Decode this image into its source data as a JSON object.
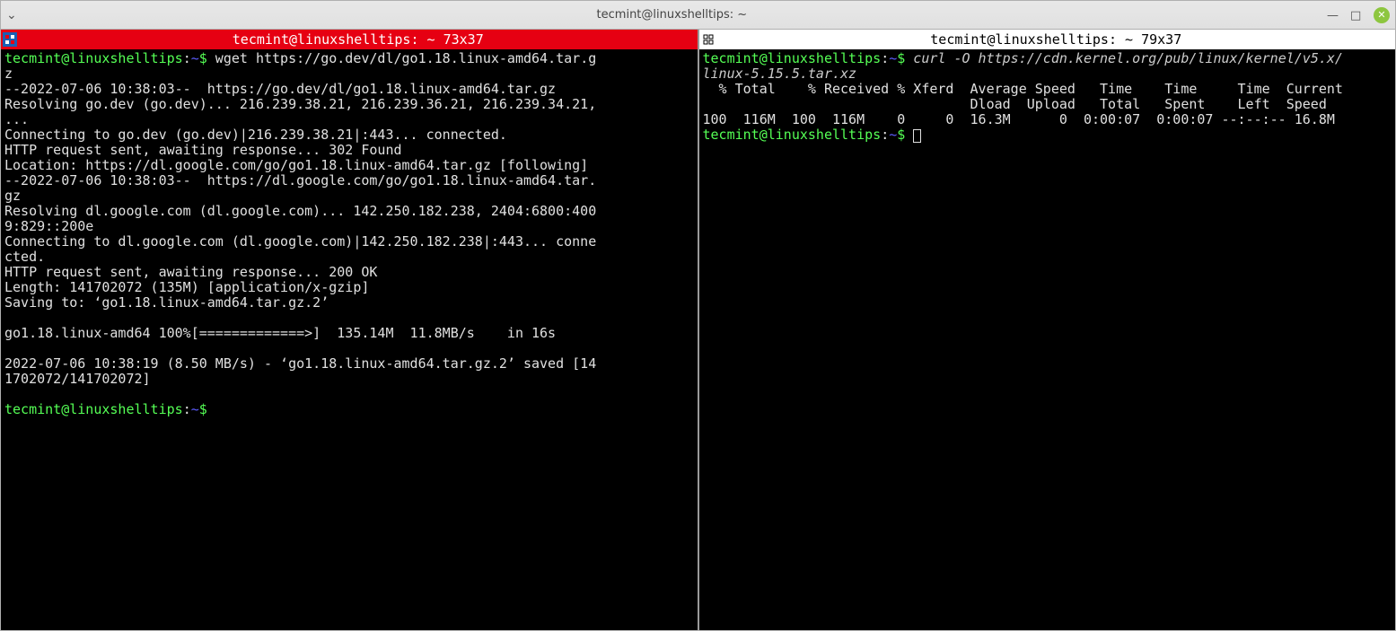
{
  "window": {
    "title": "tecmint@linuxshelltips: ~"
  },
  "left_pane": {
    "title": "tecmint@linuxshelltips: ~ 73x37",
    "prompt_user": "tecmint@linuxshelltips",
    "prompt_path": "~",
    "prompt_dollar": "$",
    "cmd": " wget https://go.dev/dl/go1.18.linux-amd64.tar.g\nz",
    "out": "--2022-07-06 10:38:03--  https://go.dev/dl/go1.18.linux-amd64.tar.gz\nResolving go.dev (go.dev)... 216.239.38.21, 216.239.36.21, 216.239.34.21,\n...\nConnecting to go.dev (go.dev)|216.239.38.21|:443... connected.\nHTTP request sent, awaiting response... 302 Found\nLocation: https://dl.google.com/go/go1.18.linux-amd64.tar.gz [following]\n--2022-07-06 10:38:03--  https://dl.google.com/go/go1.18.linux-amd64.tar.\ngz\nResolving dl.google.com (dl.google.com)... 142.250.182.238, 2404:6800:400\n9:829::200e\nConnecting to dl.google.com (dl.google.com)|142.250.182.238|:443... conne\ncted.\nHTTP request sent, awaiting response... 200 OK\nLength: 141702072 (135M) [application/x-gzip]\nSaving to: ‘go1.18.linux-amd64.tar.gz.2’\n\ngo1.18.linux-amd64 100%[=============>]  135.14M  11.8MB/s    in 16s\n\n2022-07-06 10:38:19 (8.50 MB/s) - ‘go1.18.linux-amd64.tar.gz.2’ saved [14\n1702072/141702072]\n"
  },
  "right_pane": {
    "title": "tecmint@linuxshelltips: ~ 79x37",
    "prompt_user": "tecmint@linuxshelltips",
    "prompt_path": "~",
    "prompt_dollar": "$",
    "cmd": " curl -O https://cdn.kernel.org/pub/linux/kernel/v5.x/\nlinux-5.15.5.tar.xz",
    "out": "  % Total    % Received % Xferd  Average Speed   Time    Time     Time  Current\n                                 Dload  Upload   Total   Spent    Left  Speed\n100  116M  100  116M    0     0  16.3M      0  0:00:07  0:00:07 --:--:-- 16.8M"
  }
}
